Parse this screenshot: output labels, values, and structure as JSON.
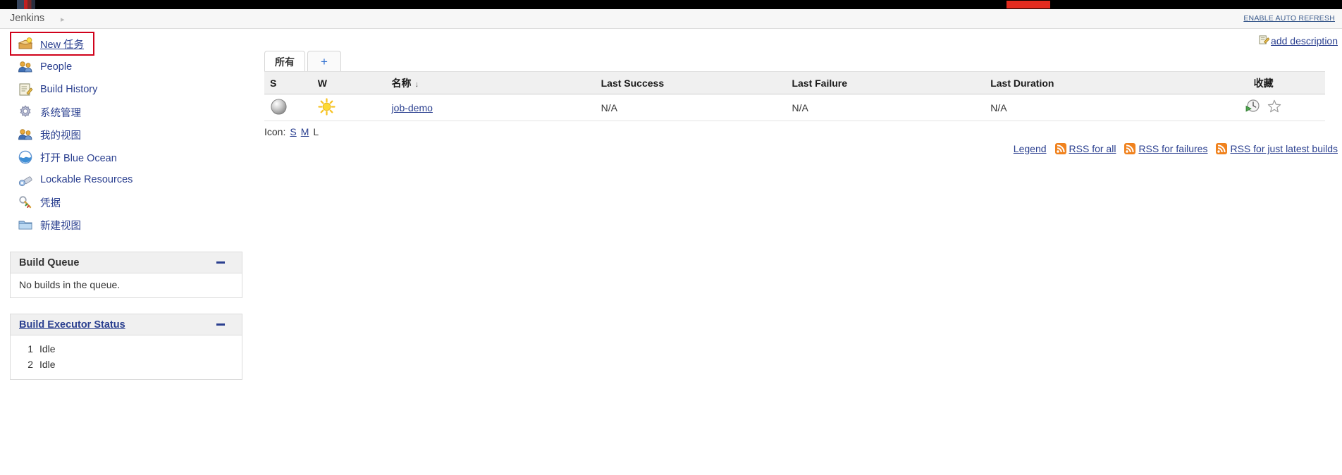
{
  "browser": {
    "bookmark_icon": "bookmark-icon",
    "red_tab": "red-tab-indicator"
  },
  "breadcrumb": {
    "root": "Jenkins",
    "arrow": "▸",
    "auto_refresh": "ENABLE AUTO REFRESH"
  },
  "sidebar": {
    "items": [
      {
        "label": "New 任务",
        "icon": "new-job-icon",
        "highlighted": true
      },
      {
        "label": "People",
        "icon": "people-icon",
        "highlighted": false
      },
      {
        "label": "Build History",
        "icon": "build-history-icon",
        "highlighted": false
      },
      {
        "label": "系统管理",
        "icon": "gear-icon",
        "highlighted": false
      },
      {
        "label": "我的视图",
        "icon": "my-views-icon",
        "highlighted": false
      },
      {
        "label": "打开 Blue Ocean",
        "icon": "blue-ocean-icon",
        "highlighted": false
      },
      {
        "label": "Lockable Resources",
        "icon": "lockable-resources-icon",
        "highlighted": false
      },
      {
        "label": "凭据",
        "icon": "credentials-icon",
        "highlighted": false
      },
      {
        "label": "新建视图",
        "icon": "new-view-folder-icon",
        "highlighted": false
      }
    ],
    "build_queue": {
      "title": "Build Queue",
      "empty_text": "No builds in the queue.",
      "collapse_icon": "collapse-icon"
    },
    "build_executor_status": {
      "title": "Build Executor Status",
      "collapse_icon": "collapse-icon",
      "executors": [
        {
          "num": "1",
          "state": "Idle"
        },
        {
          "num": "2",
          "state": "Idle"
        }
      ]
    }
  },
  "main": {
    "add_description": "add description",
    "add_description_icon": "edit-description-icon",
    "tabs": [
      {
        "label": "所有",
        "active": true
      },
      {
        "label": "+",
        "active": false
      }
    ],
    "table": {
      "headers": [
        "S",
        "W",
        "名称",
        "Last Success",
        "Last Failure",
        "Last Duration",
        "收藏"
      ],
      "sorted_column": "名称",
      "sort_arrow": "↓",
      "rows": [
        {
          "status_icon": "grey-ball-icon",
          "weather_icon": "sunny-weather-icon",
          "name": "job-demo",
          "last_success": "N/A",
          "last_failure": "N/A",
          "last_duration": "N/A",
          "schedule_icon": "schedule-build-icon",
          "favorite_icon": "star-outline-icon"
        }
      ]
    },
    "icon_size": {
      "label": "Icon:",
      "small": "S",
      "medium": "M",
      "large": "L"
    },
    "footer": {
      "legend": "Legend",
      "rss_all": "RSS for all",
      "rss_failures": "RSS for failures",
      "rss_latest": "RSS for just latest builds",
      "rss_icon": "rss-icon"
    }
  },
  "colors": {
    "link": "#2a3f8f",
    "highlight_border": "#d0021b",
    "header_bg": "#f0f0f0",
    "rss_orange": "#f0821e",
    "sun_yellow": "#fbcc2a"
  }
}
